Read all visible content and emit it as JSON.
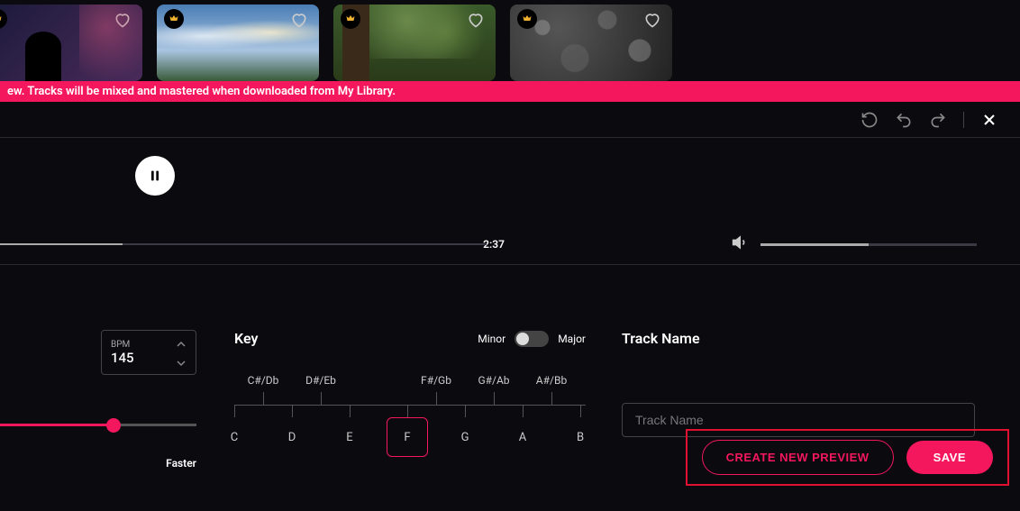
{
  "banner": "ew. Tracks will be mixed and mastered when downloaded from My Library.",
  "cards": {
    "titles": [
      "",
      "",
      "",
      ""
    ]
  },
  "player": {
    "time": "2:37",
    "progress_pct": 45,
    "volume_pct": 50
  },
  "bpm": {
    "label": "BPM",
    "value": "145",
    "slider_pct": 58,
    "faster_label": "Faster"
  },
  "key": {
    "title": "Key",
    "mode_left": "Minor",
    "mode_right": "Major",
    "mode_is_major": false,
    "sharps": [
      "C#/Db",
      "D#/Eb",
      "F#/Gb",
      "G#/Ab",
      "A#/Bb"
    ],
    "naturals": [
      "C",
      "D",
      "E",
      "F",
      "G",
      "A",
      "B"
    ],
    "selected": "F"
  },
  "track": {
    "title": "Track Name",
    "placeholder": "Track Name",
    "value": ""
  },
  "actions": {
    "preview": "CREATE NEW PREVIEW",
    "save": "SAVE"
  },
  "colors": {
    "accent": "#f5175d"
  }
}
